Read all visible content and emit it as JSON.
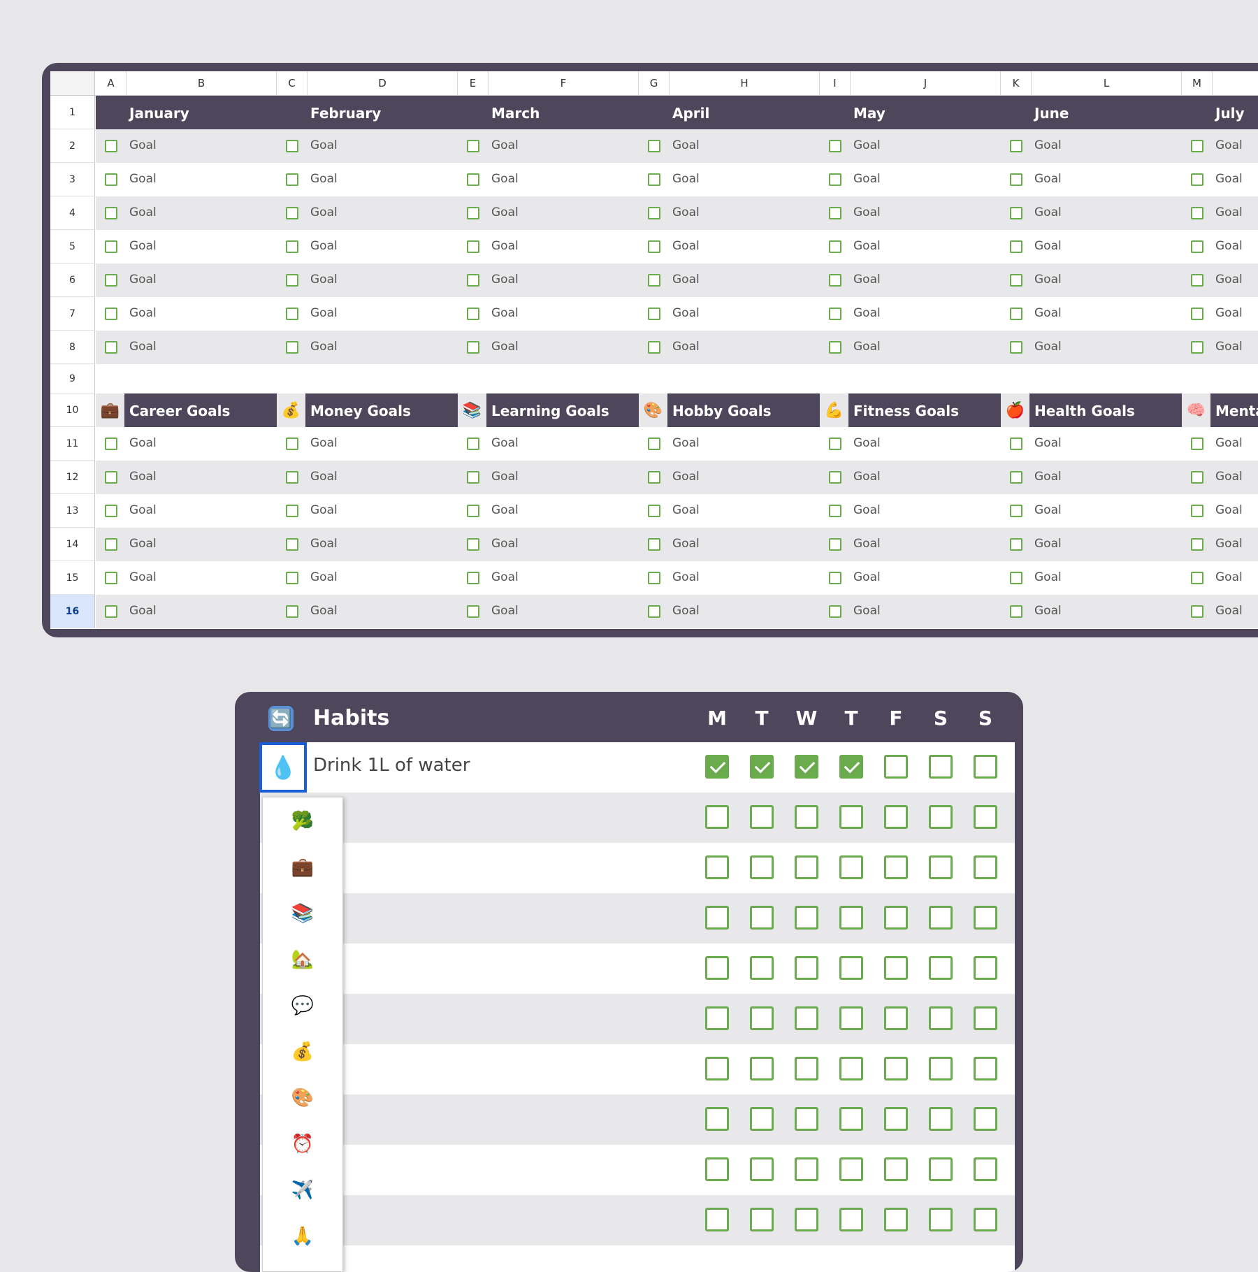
{
  "sheet": {
    "column_letters": [
      "A",
      "B",
      "C",
      "D",
      "E",
      "F",
      "G",
      "H",
      "I",
      "J",
      "K",
      "L",
      "M"
    ],
    "row_numbers": [
      "1",
      "2",
      "3",
      "4",
      "5",
      "6",
      "7",
      "8",
      "9",
      "10",
      "11",
      "12",
      "13",
      "14",
      "15",
      "16"
    ],
    "active_row": "16",
    "months": [
      "January",
      "February",
      "March",
      "April",
      "May",
      "June",
      "July"
    ],
    "goal_label": "Goal",
    "categories": [
      {
        "emoji": "💼",
        "label": "Career Goals"
      },
      {
        "emoji": "💰",
        "label": "Money Goals"
      },
      {
        "emoji": "📚",
        "label": "Learning Goals"
      },
      {
        "emoji": "🎨",
        "label": "Hobby Goals"
      },
      {
        "emoji": "💪",
        "label": "Fitness Goals"
      },
      {
        "emoji": "🍎",
        "label": "Health Goals"
      },
      {
        "emoji": "🧠",
        "label": "Menta"
      }
    ],
    "colors": {
      "header_bg": "#4e475b",
      "checkbox": "#6aab4d",
      "grey_row": "#e8e8ea"
    }
  },
  "habits": {
    "title_icon": "🔄",
    "title": "Habits",
    "days": [
      "M",
      "T",
      "W",
      "T",
      "F",
      "S",
      "S"
    ],
    "first_habit": {
      "emoji": "💧",
      "label": "Drink 1L of water",
      "checked": [
        true,
        true,
        true,
        true,
        false,
        false,
        false
      ]
    },
    "empty_rows": 9,
    "emoji_options": [
      "🥦",
      "💼",
      "📚",
      "🏡",
      "💬",
      "💰",
      "🎨",
      "⏰",
      "✈️",
      "🙏"
    ]
  }
}
